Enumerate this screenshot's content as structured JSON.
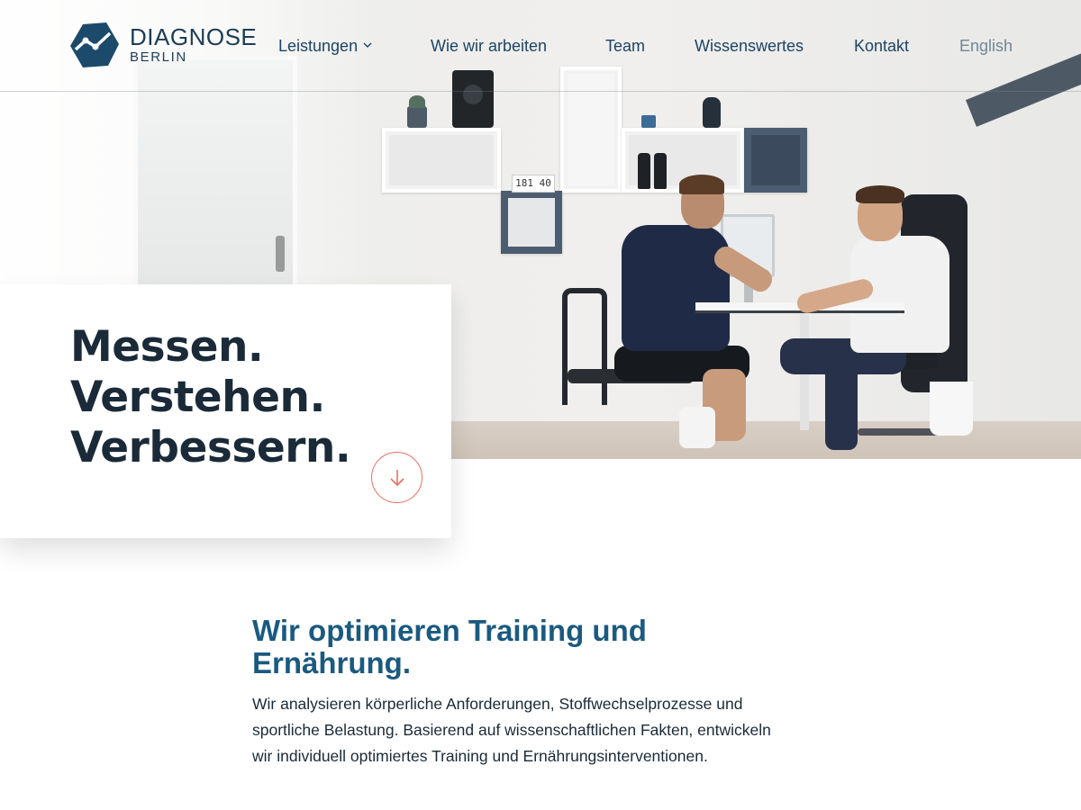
{
  "brand": {
    "name": "DIAGNOSE",
    "subname": "BERLIN",
    "logo_icon": "hexagon-chart-logo-icon",
    "color": "#1c4a6a"
  },
  "nav": {
    "items": [
      {
        "label": "Leistungen",
        "has_dropdown": true
      },
      {
        "label": "Wie wir arbeiten"
      },
      {
        "label": "Team"
      },
      {
        "label": "Wissenswertes"
      },
      {
        "label": "Kontakt"
      },
      {
        "label": "English"
      }
    ],
    "dropdown_icon": "chevron-down-icon"
  },
  "hero": {
    "lines": [
      "Messen.",
      "Verstehen.",
      "Verbessern."
    ],
    "scroll_icon": "arrow-down-icon",
    "accent": "#ea6f5c",
    "clock_display": "181 40"
  },
  "intro": {
    "heading_line1": "Wir optimieren Training und",
    "heading_line2": "Ernährung.",
    "body_line1": "Wir analysieren körperliche Anforderungen, Stoffwechselprozesse und",
    "body_line2": "sportliche Belastung. Basierend auf wissenschaftlichen Fakten, entwickeln",
    "body_line3": "wir individuell optimiertes Training und Ernährungsinterventionen.",
    "heading_color": "#1b5a80"
  }
}
